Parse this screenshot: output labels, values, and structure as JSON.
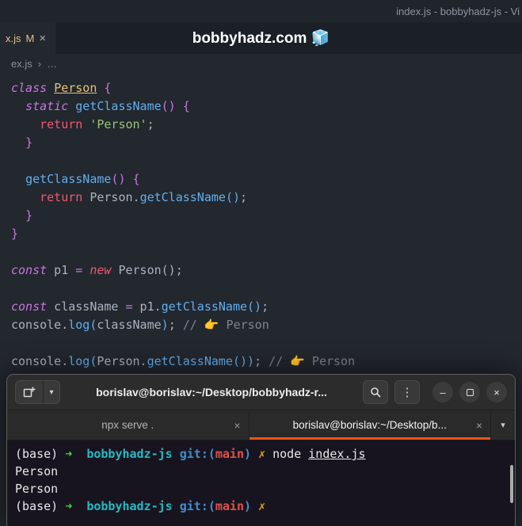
{
  "window": {
    "title_right": "index.js - bobbyhadz-js - Vi",
    "watermark": "bobbyhadz.com 🧊"
  },
  "editor": {
    "tab": {
      "label": "x.js",
      "badge": "M",
      "close": "×"
    },
    "breadcrumb": {
      "file": "ex.js",
      "separator": "›",
      "more": "…"
    },
    "lines": [
      [
        [
          "kwi",
          "class"
        ],
        [
          "txt",
          " "
        ],
        [
          "cls",
          "Person"
        ],
        [
          "txt",
          " "
        ],
        [
          "pur",
          "{"
        ]
      ],
      [
        [
          "txt",
          "  "
        ],
        [
          "kwi",
          "static"
        ],
        [
          "txt",
          " "
        ],
        [
          "fn",
          "getClassName"
        ],
        [
          "pur",
          "()"
        ],
        [
          "txt",
          " "
        ],
        [
          "pur",
          "{"
        ]
      ],
      [
        [
          "txt",
          "    "
        ],
        [
          "red",
          "return"
        ],
        [
          "txt",
          " "
        ],
        [
          "str",
          "'Person'"
        ],
        [
          "txt",
          ";"
        ]
      ],
      [
        [
          "txt",
          "  "
        ],
        [
          "pur",
          "}"
        ]
      ],
      [],
      [
        [
          "txt",
          "  "
        ],
        [
          "fn",
          "getClassName"
        ],
        [
          "pur",
          "()"
        ],
        [
          "txt",
          " "
        ],
        [
          "pur",
          "{"
        ]
      ],
      [
        [
          "txt",
          "    "
        ],
        [
          "red",
          "return"
        ],
        [
          "txt",
          " Person."
        ],
        [
          "fn",
          "getClassName"
        ],
        [
          "fn",
          "()"
        ],
        [
          "txt",
          ";"
        ]
      ],
      [
        [
          "txt",
          "  "
        ],
        [
          "pur",
          "}"
        ]
      ],
      [
        [
          "pur",
          "}"
        ]
      ],
      [],
      [
        [
          "kwi",
          "const"
        ],
        [
          "txt",
          " p1 "
        ],
        [
          "pur",
          "="
        ],
        [
          "txt",
          " "
        ],
        [
          "redi",
          "new"
        ],
        [
          "txt",
          " Person();"
        ]
      ],
      [],
      [
        [
          "kwi",
          "const"
        ],
        [
          "txt",
          " className "
        ],
        [
          "pur",
          "="
        ],
        [
          "txt",
          " p1."
        ],
        [
          "fn",
          "getClassName"
        ],
        [
          "fn",
          "()"
        ],
        [
          "txt",
          ";"
        ]
      ],
      [
        [
          "txt",
          "console."
        ],
        [
          "fn",
          "log"
        ],
        [
          "fn",
          "("
        ],
        [
          "txt",
          "className"
        ],
        [
          "fn",
          ")"
        ],
        [
          "txt",
          "; "
        ],
        [
          "cmt",
          "// 👉 Person"
        ]
      ],
      [],
      [
        [
          "txt",
          "console."
        ],
        [
          "fn",
          "log"
        ],
        [
          "fn",
          "("
        ],
        [
          "txt",
          "Person."
        ],
        [
          "fn",
          "getClassName"
        ],
        [
          "fn",
          "())"
        ],
        [
          "txt",
          "; "
        ],
        [
          "cmt",
          "// 👉 Person"
        ]
      ]
    ]
  },
  "terminal": {
    "header": {
      "title": "borislav@borislav:~/Desktop/bobbyhadz-r..."
    },
    "tabs": [
      {
        "label": "npx serve .",
        "close": "×",
        "active": false
      },
      {
        "label": "borislav@borislav:~/Desktop/b...",
        "close": "×",
        "active": true
      }
    ],
    "lines": [
      [
        [
          "w",
          "(base) "
        ],
        [
          "garr",
          "➜"
        ],
        [
          "w",
          "  "
        ],
        [
          "cyan",
          "bobbyhadz-js"
        ],
        [
          "w",
          " "
        ],
        [
          "blue",
          "git:("
        ],
        [
          "redb",
          "main"
        ],
        [
          "blue",
          ")"
        ],
        [
          "w",
          " "
        ],
        [
          "yel",
          "✗"
        ],
        [
          "w",
          " node "
        ],
        [
          "und",
          "index.js"
        ]
      ],
      [
        [
          "w",
          "Person"
        ]
      ],
      [
        [
          "w",
          "Person"
        ]
      ],
      [
        [
          "w",
          "(base) "
        ],
        [
          "garr",
          "➜"
        ],
        [
          "w",
          "  "
        ],
        [
          "cyan",
          "bobbyhadz-js"
        ],
        [
          "w",
          " "
        ],
        [
          "blue",
          "git:("
        ],
        [
          "redb",
          "main"
        ],
        [
          "blue",
          ")"
        ],
        [
          "w",
          " "
        ],
        [
          "yel",
          "✗"
        ],
        [
          "w",
          " "
        ]
      ]
    ]
  },
  "icons": {
    "chevron_down": "▾",
    "kebab": "⋮",
    "minimize": "–",
    "close": "×"
  },
  "colors": {
    "accent_orange": "#e95420",
    "modified_badge": "#e2c08d",
    "editor_bg": "#23272e",
    "terminal_bg": "#18141f"
  }
}
